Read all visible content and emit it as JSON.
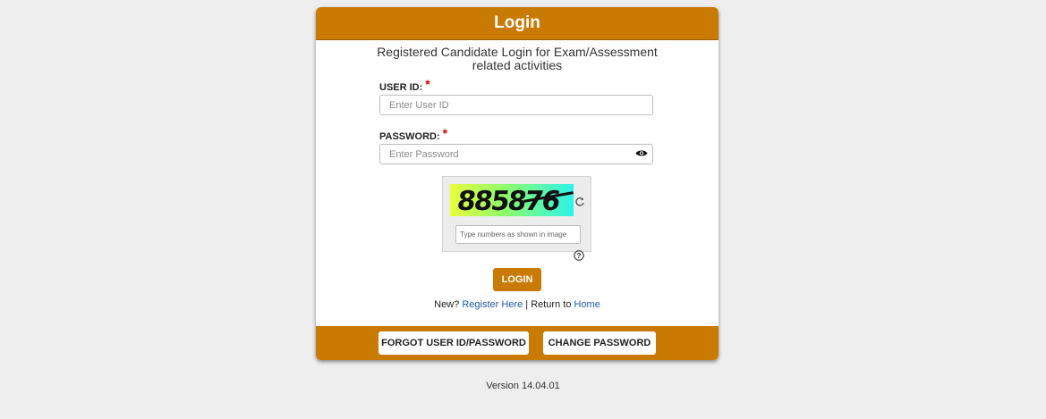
{
  "header": {
    "title": "Login"
  },
  "subtitle": "Registered Candidate Login for Exam/Assessment related activities",
  "user_id": {
    "label": "USER ID:",
    "required": "*",
    "placeholder": "Enter User ID"
  },
  "password": {
    "label": "PASSWORD:",
    "required": "*",
    "placeholder": "Enter Password"
  },
  "captcha": {
    "text": "885876",
    "placeholder": "Type numbers as shown in image",
    "refresh_icon": "refresh-icon",
    "help_icon": "help-icon"
  },
  "login_button": "LOGIN",
  "links": {
    "new_text": "New?",
    "register": "Register Here",
    "separator": "|",
    "return_text": "Return to",
    "home": "Home"
  },
  "footer": {
    "forgot": "FORGOT USER ID/PASSWORD",
    "change": "CHANGE PASSWORD"
  },
  "version": "Version 14.04.01",
  "colors": {
    "accent": "#c97a02",
    "link": "#1d5aa8",
    "required": "#d00000"
  }
}
